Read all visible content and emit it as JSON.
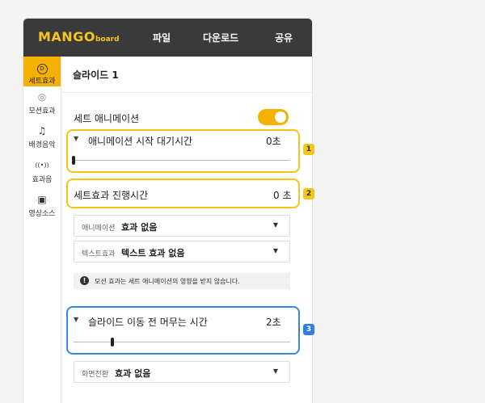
{
  "app": {
    "logo_main": "MANGO",
    "logo_sub": "board",
    "menu": [
      "파일",
      "다운로드",
      "공유"
    ]
  },
  "sidebar": [
    {
      "icon": "D",
      "label": "세트효과",
      "active": true
    },
    {
      "icon": "◎",
      "label": "모션효과",
      "active": false
    },
    {
      "icon": "♫",
      "label": "배경음악",
      "active": false
    },
    {
      "icon": "((•))",
      "label": "효과음",
      "active": false
    },
    {
      "icon": "▣",
      "label": "영상소스",
      "active": false
    }
  ],
  "header": {
    "title": "슬라이드 1"
  },
  "set_animation": {
    "label": "세트 애니메이션",
    "enabled": true
  },
  "section1": {
    "label": "애니메이션 시작 대기시간",
    "value": "0초",
    "slider_fraction": 0,
    "badge": "1"
  },
  "section2": {
    "label": "세트효과 진행시간",
    "value": "0 초",
    "badge": "2"
  },
  "selects": {
    "animation": {
      "key": "애니메이션",
      "value": "효과 없음"
    },
    "text_effect": {
      "key": "텍스트효과",
      "value": "텍스트 효과 없음"
    },
    "transition": {
      "key": "화면전환",
      "value": "효과 없음"
    }
  },
  "notice": {
    "icon": "!",
    "text": "모션 효과는 세트 애니메이션의 영향을 받지 않습니다."
  },
  "section3": {
    "label": "슬라이드 이동 전 머무는 시간",
    "value": "2초",
    "slider_fraction": 0.18,
    "badge": "3"
  },
  "colors": {
    "accent": "#f5b100",
    "topbar": "#3a3a3a",
    "blue": "#3a86d8"
  }
}
